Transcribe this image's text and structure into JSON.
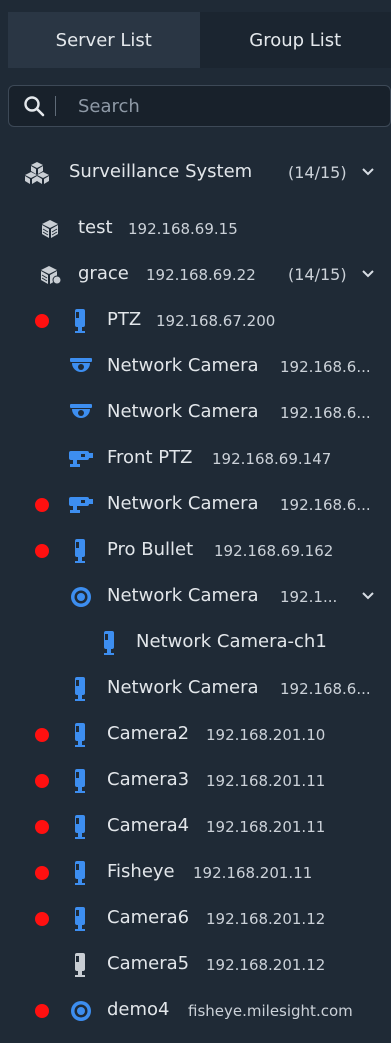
{
  "tabs": [
    {
      "label": "Server List"
    },
    {
      "label": "Group List"
    }
  ],
  "search": {
    "placeholder": "Search"
  },
  "root": {
    "name": "Surveillance System",
    "count": "(14/15)"
  },
  "servers": [
    {
      "name": "test",
      "ip": "192.168.69.15"
    },
    {
      "name": "grace",
      "ip": "192.168.69.22",
      "count": "(14/15)"
    }
  ],
  "devices": [
    {
      "name": "PTZ",
      "ip": "192.168.67.200"
    },
    {
      "name": "Network Camera",
      "ip": "192.168.6..."
    },
    {
      "name": "Network Camera",
      "ip": "192.168.6..."
    },
    {
      "name": "Front PTZ",
      "ip": "192.168.69.147"
    },
    {
      "name": "Network Camera",
      "ip": "192.168.6..."
    },
    {
      "name": "Pro Bullet",
      "ip": "192.168.69.162"
    },
    {
      "name": "Network Camera",
      "ip": "192.1..."
    },
    {
      "name": "Network Camera-ch1"
    },
    {
      "name": "Network Camera",
      "ip": "192.168.6..."
    },
    {
      "name": "Camera2",
      "ip": "192.168.201.10"
    },
    {
      "name": "Camera3",
      "ip": "192.168.201.11"
    },
    {
      "name": "Camera4",
      "ip": "192.168.201.11"
    },
    {
      "name": "Fisheye",
      "ip": "192.168.201.11"
    },
    {
      "name": "Camera6",
      "ip": "192.168.201.12"
    },
    {
      "name": "Camera5",
      "ip": "192.168.201.12"
    },
    {
      "name": "demo4",
      "ip": "fisheye.milesight.com"
    }
  ],
  "colors": {
    "offline_dot": "#ff1010",
    "icon_blue": "#3d8ef0",
    "icon_gray": "#c9ced4"
  }
}
